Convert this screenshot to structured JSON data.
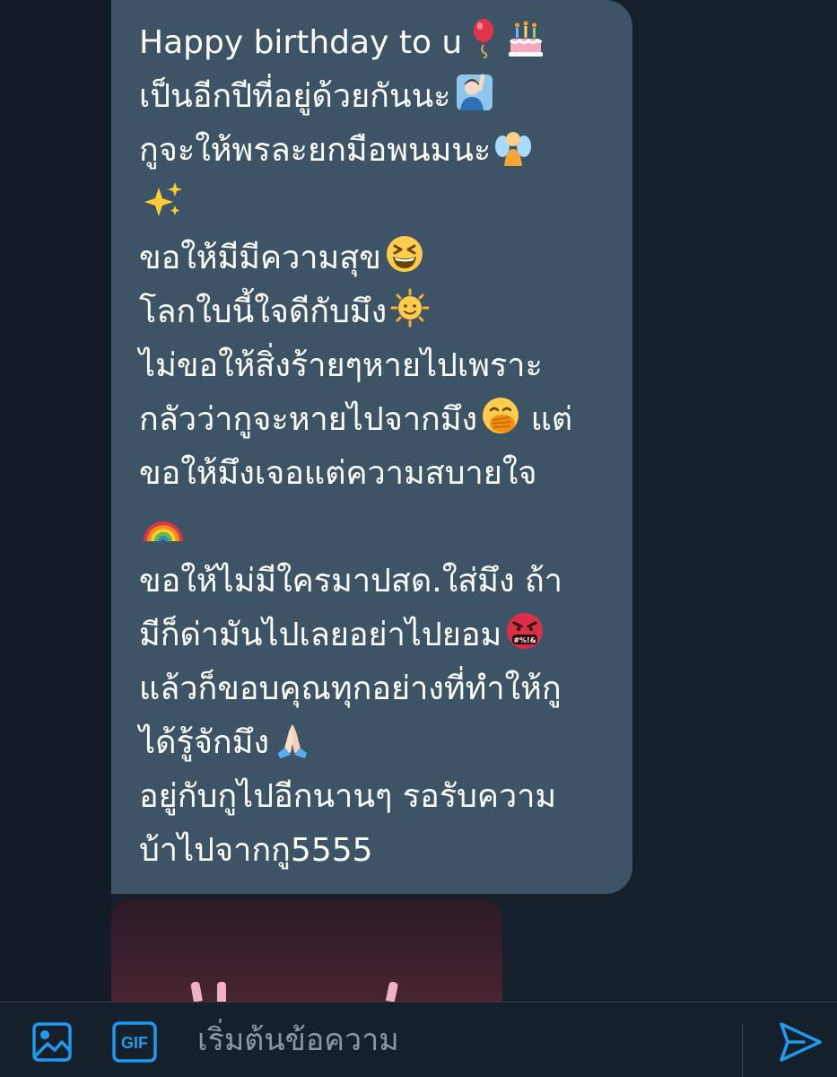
{
  "message": {
    "lines": [
      {
        "text": "Happy birthday to u",
        "emoji": [
          "balloon-icon",
          "birthday-cake-icon"
        ]
      },
      {
        "text": "เป็นอีกปีที่อยู่ด้วยกันนะ",
        "emoji": [
          "person-raising-hand-icon"
        ]
      },
      {
        "text": "กูจะให้พรละยกมือพนมนะ",
        "emoji": [
          "fairy-icon"
        ]
      },
      {
        "text": "",
        "emoji": [
          "sparkles-icon"
        ]
      },
      {
        "text": "ขอให้มีมีความสุข",
        "emoji": [
          "grinning-squinting-face-icon"
        ]
      },
      {
        "text": "โลกใบนี้ใจดีกับมึง",
        "emoji": [
          "sun-with-face-icon"
        ]
      },
      {
        "text": "ไม่ขอให้สิ่งร้ายๆหายไปเพราะ",
        "emoji": []
      },
      {
        "text": "กลัวว่ากูจะหายไปจากมึง",
        "emoji": [
          "face-with-hand-over-mouth-icon"
        ],
        "after": " แต่"
      },
      {
        "text": "ขอให้มึงเจอแต่ความสบายใจ",
        "emoji": []
      },
      {
        "text": "",
        "emoji": [
          "rainbow-icon"
        ]
      },
      {
        "text": "ขอให้ไม่มีใครมาปสด.ใส่มึง ถ้า",
        "emoji": []
      },
      {
        "text": "มีก็ด่ามันไปเลยอย่าไปยอม",
        "emoji": [
          "face-with-symbols-on-mouth-icon"
        ]
      },
      {
        "text": "แล้วก็ขอบคุณทุกอย่างที่ทำให้กู",
        "emoji": []
      },
      {
        "text": "ได้รู้จักมึง",
        "emoji": [
          "folded-hands-icon"
        ]
      },
      {
        "text": "อยู่กับกูไปอีกนานๆ รอรับความ",
        "emoji": []
      },
      {
        "text": "บ้าไปจากกู5555",
        "emoji": []
      }
    ]
  },
  "composer": {
    "placeholder": "เริ่มต้นข้อความ",
    "gif_label": "GIF",
    "image_icon": "image-icon",
    "send_icon": "send-icon"
  },
  "colors": {
    "background": "#15202b",
    "bubble": "#3d5466",
    "accent": "#1d9bf0",
    "placeholder": "#8899a6"
  }
}
